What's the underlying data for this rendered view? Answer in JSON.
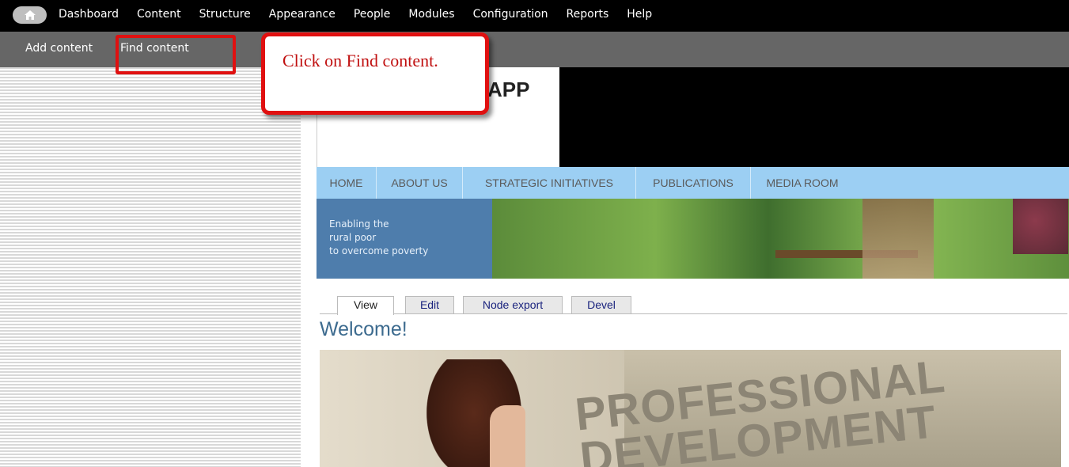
{
  "toolbar": {
    "menu": [
      "Dashboard",
      "Content",
      "Structure",
      "Appearance",
      "People",
      "Modules",
      "Configuration",
      "Reports",
      "Help"
    ]
  },
  "shortcuts": {
    "add_content": "Add content",
    "find_content": "Find content"
  },
  "callout": {
    "text": "Click on Find content."
  },
  "site": {
    "name": "APP"
  },
  "nav": [
    "HOME",
    "ABOUT US",
    "STRATEGIC INITIATIVES",
    "PUBLICATIONS",
    "MEDIA ROOM"
  ],
  "banner": {
    "line1": "Enabling the",
    "line2": "rural poor",
    "line3": "to overcome poverty"
  },
  "tabs": [
    "View",
    "Edit",
    "Node export",
    "Devel"
  ],
  "page": {
    "title": "Welcome!"
  },
  "photo": {
    "line1": "PROFESSIONAL",
    "line2": "DEVELOPMENT"
  },
  "colors": {
    "highlight": "#e01010",
    "navbar": "#9ccff3",
    "title": "#3d6b8f"
  }
}
